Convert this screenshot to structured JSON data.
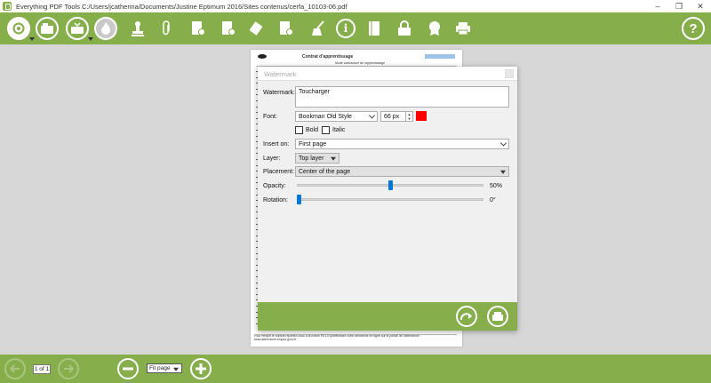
{
  "window": {
    "title": "Everything PDF Tools  C:/Users/jcatherina/Documents/Justine Eptimum 2016/Sites contenus/cerfa_10103-06.pdf"
  },
  "toolbar": {
    "items": [
      {
        "name": "convert-icon"
      },
      {
        "name": "open-file-icon"
      },
      {
        "name": "save-icon"
      },
      {
        "name": "flame-icon"
      },
      {
        "name": "stamp-icon"
      },
      {
        "name": "paperclip-icon"
      },
      {
        "name": "add-pages-icon"
      },
      {
        "name": "eraser-icon"
      },
      {
        "name": "merge-icon"
      },
      {
        "name": "broom-icon"
      },
      {
        "name": "info-icon"
      },
      {
        "name": "book-icon"
      },
      {
        "name": "lock-icon"
      },
      {
        "name": "badge-icon"
      },
      {
        "name": "printer-icon"
      },
      {
        "name": "help-icon"
      }
    ]
  },
  "document": {
    "title": "Contrat d'apprentissage",
    "subtitle": "Mode contractuel de l'apprentissage",
    "footer": "Pour remplir le contrat reportez-vous à la notice FA 14 qu'effectuez votre démarche en ligne sur le portail de l'alternance : www.alternance.emploi.gouv.fr"
  },
  "dialog": {
    "title": "Watermark",
    "watermark_label": "Watermark:",
    "watermark_value": "Toucharger",
    "font_label": "Font:",
    "font_value": "Bookman Old Style",
    "font_size": "66 px",
    "color": "#ff0000",
    "bold_label": "Bold",
    "italic_label": "Italic",
    "bold_checked": false,
    "italic_checked": false,
    "insert_on_label": "Insert on:",
    "insert_on_value": "First page",
    "layer_label": "Layer:",
    "layer_value": "Top layer",
    "placement_label": "Placement:",
    "placement_value": "Center of the page",
    "opacity_label": "Opacity:",
    "opacity_value": "50%",
    "opacity_fraction": 0.5,
    "rotation_label": "Rotation:",
    "rotation_value": "0°",
    "rotation_fraction": 0
  },
  "bottombar": {
    "page_indicator": "1 of 1",
    "zoom_value": "Fit page"
  },
  "colors": {
    "accent": "#86ae4b",
    "slider_thumb": "#0078d7"
  }
}
